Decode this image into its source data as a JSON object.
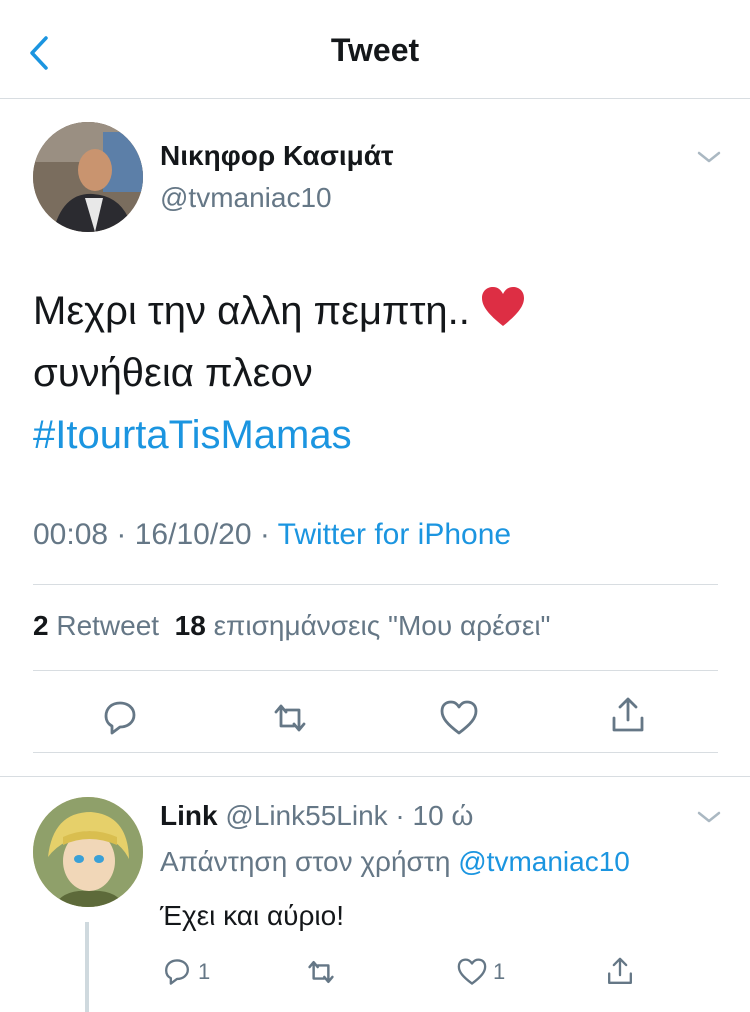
{
  "header": {
    "title": "Tweet"
  },
  "tweet": {
    "author_name": "Νικηφορ Κασιμάτ",
    "author_handle": "@tvmaniac10",
    "text_line1": "Μεχρι την αλλη πεμπτη..",
    "text_line2": "συνήθεια πλεον",
    "hashtag": "#ItourtaTisMamas",
    "time": "00:08",
    "date": "16/10/20",
    "source": "Twitter for iPhone",
    "retweet_count": "2",
    "retweet_label": "Retweet",
    "like_count": "18",
    "like_label": "επισημάνσεις \"Μου αρέσει\""
  },
  "reply": {
    "author_name": "Link",
    "author_handle": "@Link55Link",
    "age": "10 ώ",
    "reply_prefix": "Απάντηση στον χρήστη",
    "reply_to": "@tvmaniac10",
    "text": "Έχει και αύριο!",
    "reply_count": "1",
    "like_count": "1"
  },
  "colors": {
    "accent": "#1b95e0",
    "muted": "#657786",
    "heart": "#e0245e"
  },
  "icons": [
    "back-chevron-icon",
    "chevron-down-icon",
    "reply-icon",
    "retweet-icon",
    "like-icon",
    "share-icon",
    "heart-emoji-icon"
  ]
}
